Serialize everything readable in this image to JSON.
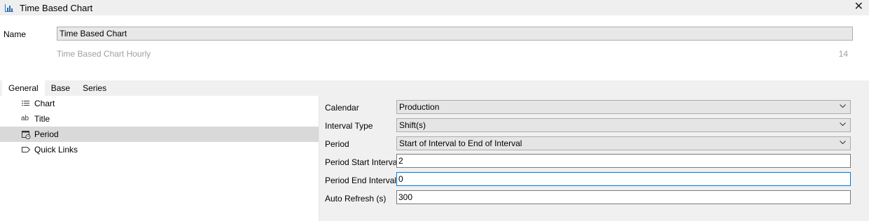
{
  "window": {
    "title": "Time Based Chart",
    "app_icon": "bar-chart-icon",
    "close_glyph": "✕"
  },
  "name_field": {
    "label": "Name",
    "value": "Time Based Chart"
  },
  "description": "Time Based Chart Hourly",
  "count": "14",
  "tabs": [
    {
      "label": "General",
      "active": true
    },
    {
      "label": "Base",
      "active": false
    },
    {
      "label": "Series",
      "active": false
    }
  ],
  "tree": [
    {
      "label": "Chart",
      "icon": "list-icon",
      "selected": false
    },
    {
      "label": "Title",
      "icon": "text-ab-icon",
      "selected": false
    },
    {
      "label": "Period",
      "icon": "calendar-clock-icon",
      "selected": true
    },
    {
      "label": "Quick Links",
      "icon": "tag-icon",
      "selected": false
    }
  ],
  "properties": {
    "calendar": {
      "label": "Calendar",
      "value": "Production"
    },
    "interval_type": {
      "label": "Interval Type",
      "value": "Shift(s)"
    },
    "period": {
      "label": "Period",
      "value": "Start of Interval to End of Interval"
    },
    "period_start": {
      "label": "Period Start Intervals",
      "value": "2"
    },
    "period_end": {
      "label": "Period End Intervals",
      "value": "0"
    },
    "auto_refresh": {
      "label": "Auto Refresh (s)",
      "value": "300"
    }
  },
  "colors": {
    "selection": "#d9d9d9",
    "focus_border": "#0078d7",
    "muted_text": "#a0a0a0"
  }
}
